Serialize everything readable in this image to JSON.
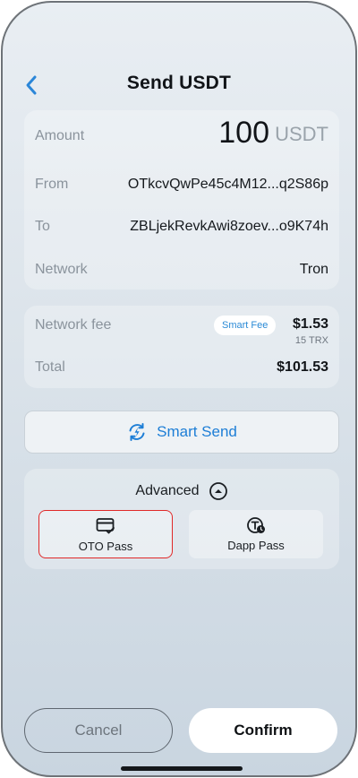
{
  "header": {
    "title": "Send USDT",
    "back_icon": "chevron-left-icon"
  },
  "transaction": {
    "amount_label": "Amount",
    "amount_value": "100",
    "amount_unit": "USDT",
    "from_label": "From",
    "from_value": "OTkcvQwPe45c4M12...q2S86p",
    "to_label": "To",
    "to_value": "ZBLjekRevkAwi8zoev...o9K74h",
    "network_label": "Network",
    "network_value": "Tron"
  },
  "fees": {
    "network_fee_label": "Network fee",
    "smart_fee_badge": "Smart Fee",
    "network_fee_usd": "$1.53",
    "network_fee_trx": "15 TRX",
    "total_label": "Total",
    "total_value": "$101.53"
  },
  "smart_send": {
    "label": "Smart Send",
    "icon": "refresh-lightning-icon"
  },
  "advanced": {
    "title": "Advanced",
    "toggle_icon": "chevron-up-circle-icon",
    "passes": [
      {
        "label": "OTO Pass",
        "icon": "card-check-icon",
        "selected": true
      },
      {
        "label": "Dapp Pass",
        "icon": "token-clock-icon",
        "selected": false
      }
    ]
  },
  "actions": {
    "cancel_label": "Cancel",
    "confirm_label": "Confirm"
  },
  "colors": {
    "accent": "#1d7ed6",
    "highlight_border": "#e02828",
    "primary_text": "#111418",
    "muted_text": "#8a939c"
  }
}
